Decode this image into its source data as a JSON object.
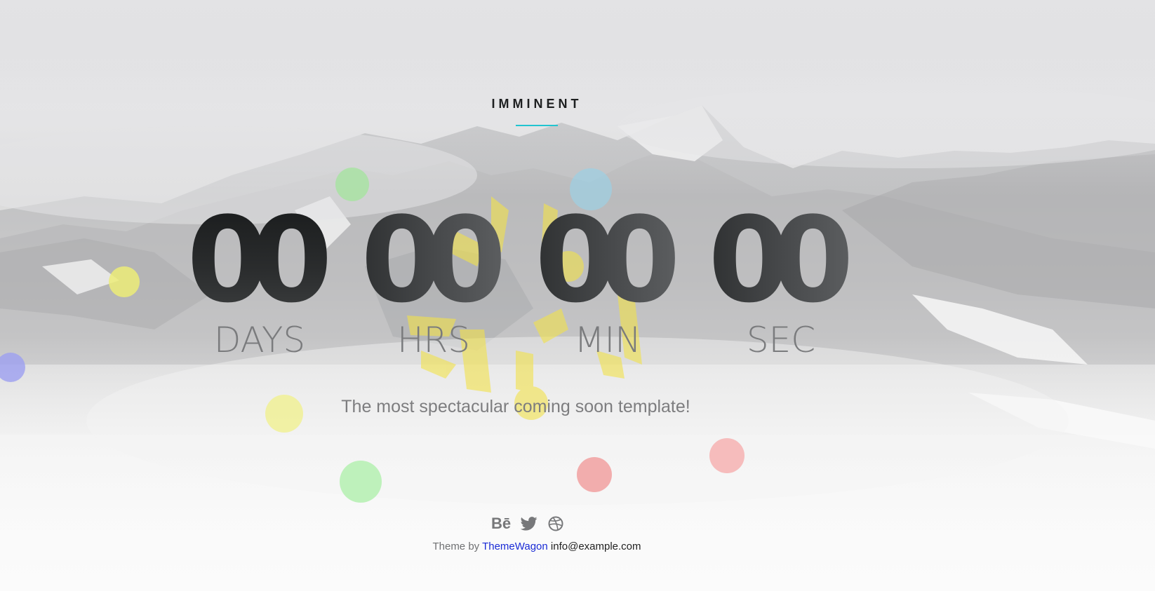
{
  "site": {
    "brand": "IMMINENT",
    "accent_color": "#22c4d0"
  },
  "countdown": {
    "units": [
      {
        "value": "00",
        "label": "DAYS"
      },
      {
        "value": "00",
        "label": "HRS"
      },
      {
        "value": "00",
        "label": "MIN"
      },
      {
        "value": "00",
        "label": "SEC"
      }
    ]
  },
  "tagline": "The most spectacular coming soon template!",
  "footer": {
    "social": [
      {
        "name": "behance",
        "text": "Bē"
      },
      {
        "name": "twitter",
        "icon": "twitter-icon"
      },
      {
        "name": "dribbble",
        "icon": "dribbble-icon"
      }
    ],
    "credit_prefix": "Theme by",
    "credit_link": "ThemeWagon",
    "email": "info@example.com"
  },
  "colors": {
    "digit": "#1b1d1e",
    "label": "#7a7b7d",
    "link": "#1a2bd6"
  }
}
